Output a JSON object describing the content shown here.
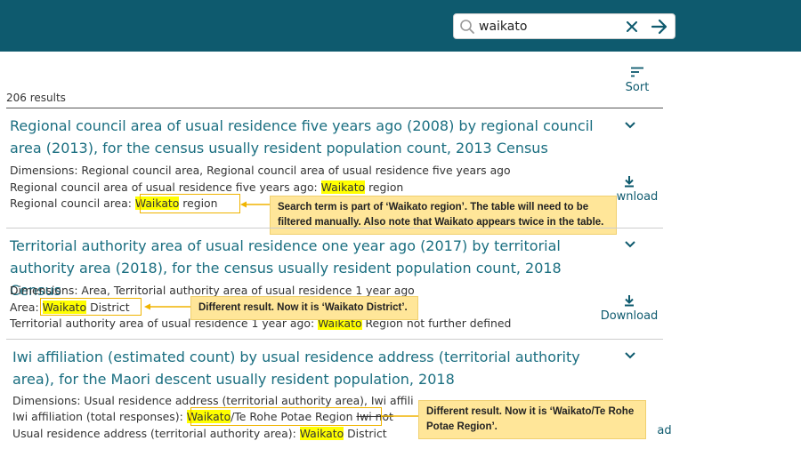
{
  "search": {
    "value": "waikato",
    "placeholder": ""
  },
  "results_count": "206 results",
  "sort_label": "Sort",
  "download_label": "Download",
  "results": [
    {
      "title": "Regional council area of usual residence five years ago (2008) by regional council area (2013), for the census usually resident population count, 2013 Census",
      "dimensions": "Dimensions: Regional council area, Regional council area of usual residence five years ago",
      "line2_pre": "Regional council area of usual residence five years ago: ",
      "line2_hl": "Waikato",
      "line2_post": " region",
      "line3_pre": "Regional council area: ",
      "line3_hl": "Waikato",
      "line3_post": " region",
      "download_partial": "wnload"
    },
    {
      "title": "Territorial authority area of usual residence one year ago (2017) by territorial authority area (2018), for the census usually resident population count, 2018 Census",
      "dimensions": "Dimensions: Area, Territorial authority area of usual residence 1 year ago",
      "line2_pre": "Area: ",
      "line2_hl": "Waikato",
      "line2_post": " District",
      "line3_pre": "Territorial authority area of usual residence 1 year ago: ",
      "line3_hl": "Waikato",
      "line3_post": " Region not further defined"
    },
    {
      "title": "Iwi affiliation (estimated count) by usual residence address (territorial authority area), for the Maori descent usually resident population, 2018",
      "dimensions": "Dimensions: Usual residence address (territorial authority area), Iwi affiliation (total responses)",
      "line2_pre": "Iwi affiliation (total responses): ",
      "line2_hl": "Waikato",
      "line2_post": "/Te Rohe Potae Region",
      "line2_tail": "Iwi not",
      "line3_pre": "Usual residence address (territorial authority area): ",
      "line3_hl": "Waikato",
      "line3_post": " District",
      "download_partial": "ad"
    }
  ],
  "callouts": {
    "c1": "Search term is part of ‘Waikato region’. The table will need to be filtered manually. Also note that Waikato appears twice in the table.",
    "c2": "Different result. Now it is ‘Waikato District’.",
    "c3": "Different result. Now it is ‘Waikato/Te Rohe Potae Region’."
  },
  "colors": {
    "header": "#0e5a6e",
    "link": "#1a6e80",
    "highlight": "#ffff00",
    "callout": "#ffe699",
    "callout_border": "#f0b400"
  },
  "icons": {
    "search": "search-icon",
    "clear": "close-icon",
    "go": "arrow-right-icon",
    "sort": "sort-icon",
    "chevron": "chevron-down-icon",
    "download": "download-icon"
  }
}
